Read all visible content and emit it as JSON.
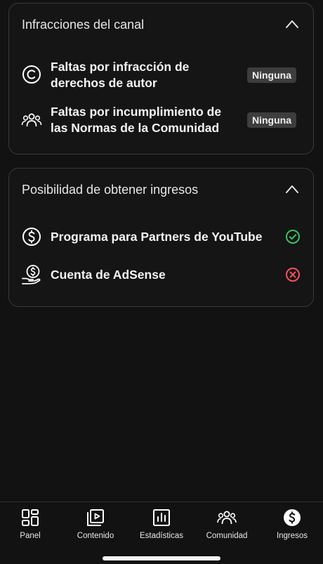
{
  "infractions": {
    "title": "Infracciones del canal",
    "rows": [
      {
        "line1": "Faltas por infracción de",
        "line2": "derechos de autor",
        "badge": "Ninguna",
        "icon": "copyright-icon"
      },
      {
        "line1": "Faltas por incumplimiento de",
        "line2": "las Normas de la Comunidad",
        "badge": "Ninguna",
        "icon": "people-icon"
      }
    ]
  },
  "monetization": {
    "title": "Posibilidad de obtener ingresos",
    "rows": [
      {
        "label": "Programa para Partners de YouTube",
        "status": "eligible",
        "icon": "dollar-circle-icon",
        "status_color": "#3ac25b"
      },
      {
        "label": "Cuenta de AdSense",
        "status": "not-linked",
        "icon": "hand-coin-icon",
        "status_color": "#ff4e5e"
      }
    ]
  },
  "nav": {
    "items": [
      {
        "label": "Panel",
        "icon": "dashboard-icon"
      },
      {
        "label": "Contenido",
        "icon": "content-icon"
      },
      {
        "label": "Estadísticas",
        "icon": "analytics-icon"
      },
      {
        "label": "Comunidad",
        "icon": "community-icon"
      },
      {
        "label": "Ingresos",
        "icon": "earn-icon",
        "active": true
      }
    ]
  },
  "colors": {
    "background": "#121212",
    "card_border": "#3a3a3a",
    "badge_bg": "#3d3d3d",
    "success": "#3ac25b",
    "error": "#ff4e5e"
  }
}
